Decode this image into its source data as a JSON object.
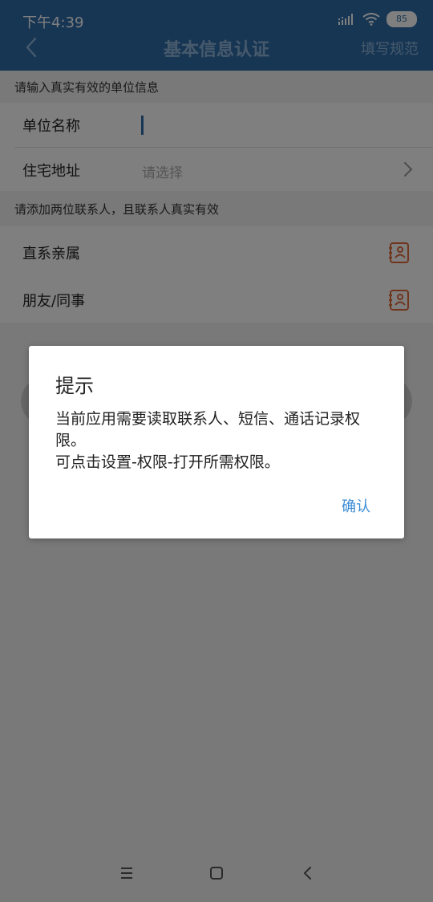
{
  "status": {
    "time": "下午4:39",
    "battery": "85"
  },
  "header": {
    "title": "基本信息认证",
    "right_link": "填写规范"
  },
  "sections": {
    "company_hint": "请输入真实有效的单位信息",
    "contacts_hint": "请添加两位联系人，且联系人真实有效"
  },
  "form": {
    "company_name_label": "单位名称",
    "address_label": "住宅地址",
    "address_placeholder": "请选择"
  },
  "contacts": {
    "relative_label": "直系亲属",
    "friend_label": "朋友/同事"
  },
  "dialog": {
    "title": "提示",
    "message_line1": "当前应用需要读取联系人、短信、通话记录权限。",
    "message_line2": "可点击设置-权限-打开所需权限。",
    "confirm": "确认"
  },
  "colors": {
    "primary": "#2f6ca8",
    "accent_icon": "#e06a3a",
    "link": "#3a8bd6"
  }
}
